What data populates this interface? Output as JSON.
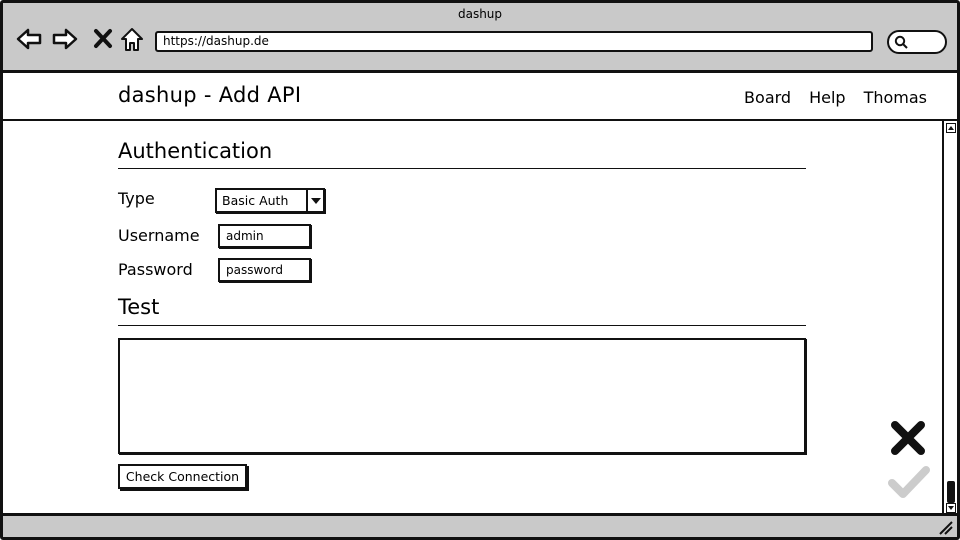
{
  "browser": {
    "window_title": "dashup",
    "url": "https://dashup.de",
    "nav_icons": [
      "back-arrow-icon",
      "forward-arrow-icon",
      "stop-x-icon",
      "home-icon"
    ],
    "search_icon": "search-icon"
  },
  "header": {
    "title": "dashup - Add API",
    "nav": [
      "Board",
      "Help",
      "Thomas"
    ]
  },
  "authentication": {
    "heading": "Authentication",
    "type_label": "Type",
    "type_value": "Basic Auth",
    "username_label": "Username",
    "username_value": "admin",
    "password_label": "Password",
    "password_value": "password"
  },
  "test": {
    "heading": "Test",
    "output": "",
    "check_button": "Check Connection"
  },
  "actions": {
    "cancel_icon": "close-x-icon",
    "confirm_icon": "checkmark-icon",
    "confirm_color": "#cccccc"
  }
}
